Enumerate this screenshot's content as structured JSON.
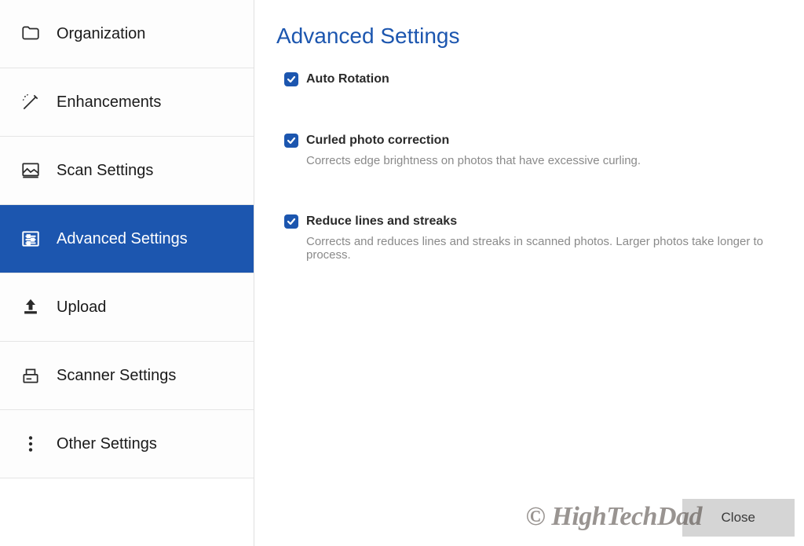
{
  "sidebar": {
    "items": [
      {
        "label": "Organization",
        "icon": "folder-icon"
      },
      {
        "label": "Enhancements",
        "icon": "wand-icon"
      },
      {
        "label": "Scan Settings",
        "icon": "image-settings-icon"
      },
      {
        "label": "Advanced Settings",
        "icon": "sliders-icon"
      },
      {
        "label": "Upload",
        "icon": "upload-icon"
      },
      {
        "label": "Scanner Settings",
        "icon": "scanner-icon"
      },
      {
        "label": "Other Settings",
        "icon": "dots-icon"
      }
    ],
    "selected_index": 3
  },
  "page": {
    "title": "Advanced Settings"
  },
  "options": [
    {
      "label": "Auto Rotation",
      "checked": true,
      "description": ""
    },
    {
      "label": "Curled photo correction",
      "checked": true,
      "description": "Corrects edge brightness on photos that have excessive curling."
    },
    {
      "label": "Reduce lines and streaks",
      "checked": true,
      "description": "Corrects and reduces lines and streaks in scanned photos. Larger photos take longer to process."
    }
  ],
  "footer": {
    "close_label": "Close"
  },
  "watermark_text": "© HighTechDad"
}
